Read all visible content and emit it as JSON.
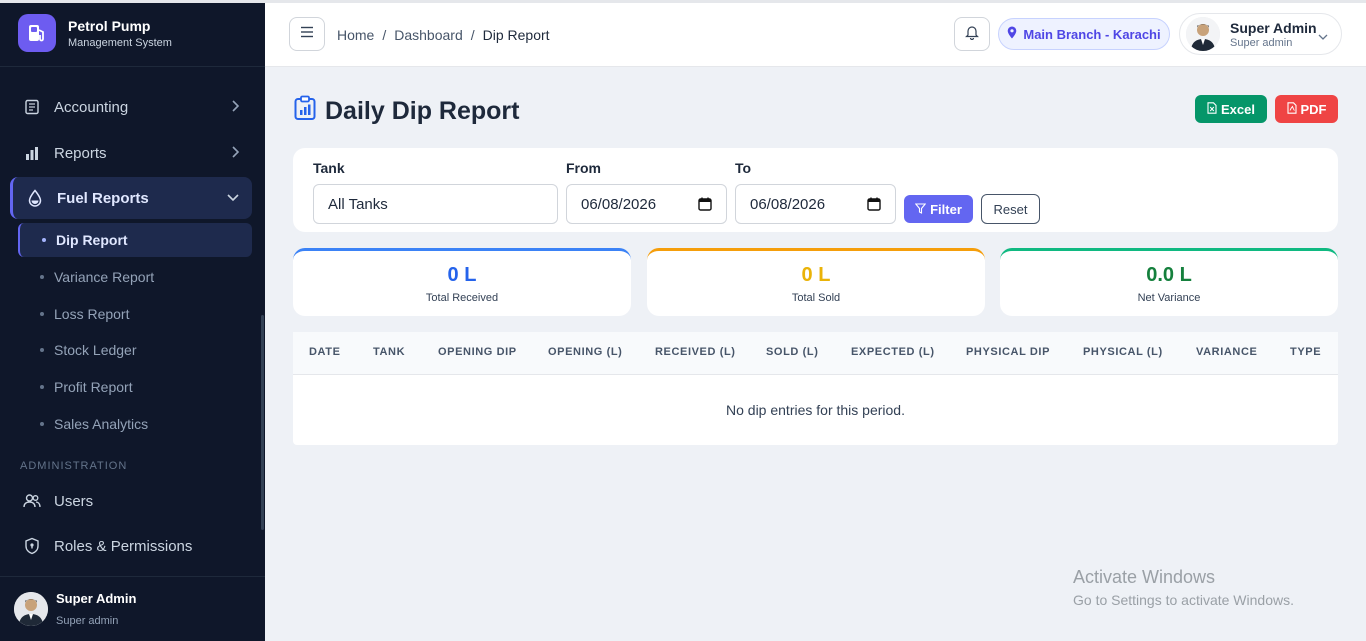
{
  "brand": {
    "title": "Petrol Pump",
    "subtitle": "Management System"
  },
  "sidebar": {
    "items": [
      {
        "label": "Accounting"
      },
      {
        "label": "Reports"
      },
      {
        "label": "Fuel Reports"
      }
    ],
    "sub_items": [
      {
        "label": "Dip Report"
      },
      {
        "label": "Variance Report"
      },
      {
        "label": "Loss Report"
      },
      {
        "label": "Stock Ledger"
      },
      {
        "label": "Profit Report"
      },
      {
        "label": "Sales Analytics"
      }
    ],
    "section_admin": "ADMINISTRATION",
    "admin_items": [
      {
        "label": "Users"
      },
      {
        "label": "Roles & Permissions"
      }
    ],
    "user": {
      "name": "Super Admin",
      "role": "Super admin"
    }
  },
  "header": {
    "breadcrumb": [
      "Home",
      "Dashboard",
      "Dip Report"
    ],
    "branch": "Main Branch - Karachi",
    "user_name": "Super Admin",
    "user_role": "Super admin"
  },
  "page": {
    "title": "Daily Dip Report",
    "excel_label": "Excel",
    "pdf_label": "PDF"
  },
  "filters": {
    "tank_label": "Tank",
    "tank_value": "All Tanks",
    "from_label": "From",
    "from_value": "06/08/2026",
    "to_label": "To",
    "to_value": "06/08/2026",
    "filter_label": "Filter",
    "reset_label": "Reset"
  },
  "stats": [
    {
      "value": "0 L",
      "label": "Total Received",
      "color": "#2563eb"
    },
    {
      "value": "0 L",
      "label": "Total Sold",
      "color": "#eab308"
    },
    {
      "value": "0.0 L",
      "label": "Net Variance",
      "color": "#15803d"
    }
  ],
  "table": {
    "columns": [
      "DATE",
      "TANK",
      "OPENING DIP",
      "OPENING (L)",
      "RECEIVED (L)",
      "SOLD (L)",
      "EXPECTED (L)",
      "PHYSICAL DIP",
      "PHYSICAL (L)",
      "VARIANCE",
      "TYPE"
    ],
    "empty_message": "No dip entries for this period."
  },
  "watermark": {
    "line1": "Activate Windows",
    "line2": "Go to Settings to activate Windows."
  },
  "colors": {
    "sidebar_bg": "#0f172a",
    "accent": "#6366f1",
    "excel": "#059669",
    "pdf": "#ef4444"
  }
}
